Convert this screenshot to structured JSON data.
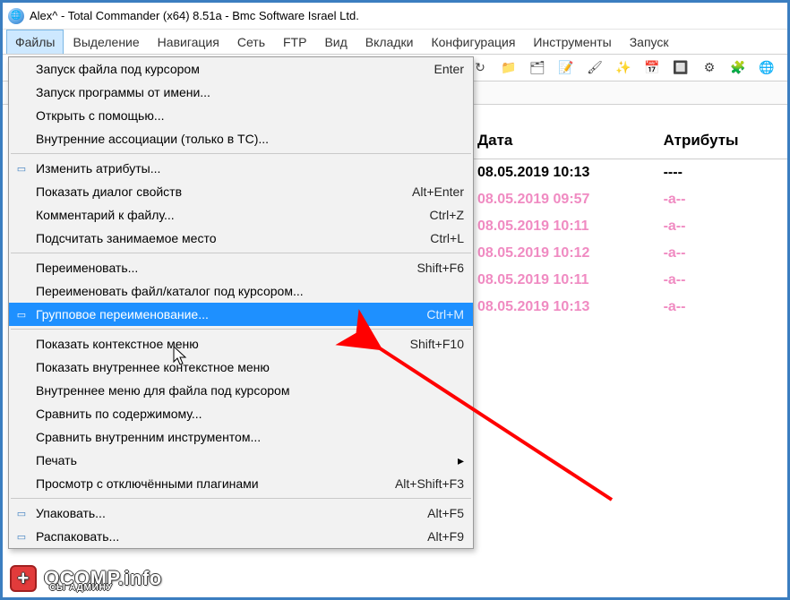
{
  "window": {
    "title": "Alex^ - Total Commander (x64) 8.51a - Bmc Software Israel Ltd."
  },
  "menubar": {
    "items": [
      "Файлы",
      "Выделение",
      "Навигация",
      "Сеть",
      "FTP",
      "Вид",
      "Вкладки",
      "Конфигурация",
      "Инструменты",
      "Запуск"
    ],
    "open_index": 0
  },
  "toolbar_icons": [
    "refresh-icon",
    "folder-icon",
    "explorer-icon",
    "notepad-icon",
    "brush-icon",
    "wand-icon",
    "calendar-icon",
    "window-icon",
    "gear-icon",
    "puzzle-icon",
    "globe-icon"
  ],
  "dropdown": {
    "groups": [
      {
        "items": [
          {
            "label": "Запуск файла под курсором",
            "shortcut": "Enter",
            "icon": null
          },
          {
            "label": "Запуск программы от имени...",
            "shortcut": "",
            "icon": null
          },
          {
            "label": "Открыть с помощью...",
            "shortcut": "",
            "icon": null
          },
          {
            "label": "Внутренние ассоциации (только в TC)...",
            "shortcut": "",
            "icon": null
          }
        ]
      },
      {
        "items": [
          {
            "label": "Изменить атрибуты...",
            "shortcut": "",
            "icon": "page-icon"
          },
          {
            "label": "Показать диалог свойств",
            "shortcut": "Alt+Enter",
            "icon": null
          },
          {
            "label": "Комментарий к файлу...",
            "shortcut": "Ctrl+Z",
            "icon": null
          },
          {
            "label": "Подсчитать занимаемое место",
            "shortcut": "Ctrl+L",
            "icon": null
          }
        ]
      },
      {
        "items": [
          {
            "label": "Переименовать...",
            "shortcut": "Shift+F6",
            "icon": null
          },
          {
            "label": "Переименовать файл/каталог под курсором...",
            "shortcut": "",
            "icon": null
          },
          {
            "label": "Групповое переименование...",
            "shortcut": "Ctrl+M",
            "icon": "rename-group-icon",
            "highlight": true
          }
        ]
      },
      {
        "items": [
          {
            "label": "Показать контекстное меню",
            "shortcut": "Shift+F10",
            "icon": null
          },
          {
            "label": "Показать внутреннее контекстное меню",
            "shortcut": "",
            "icon": null
          },
          {
            "label": "Внутреннее меню для файла под курсором",
            "shortcut": "",
            "icon": null
          },
          {
            "label": "Сравнить по содержимому...",
            "shortcut": "",
            "icon": null
          },
          {
            "label": "Сравнить внутренним инструментом...",
            "shortcut": "",
            "icon": null
          },
          {
            "label": "Печать",
            "shortcut": "",
            "icon": null,
            "submenu": true
          },
          {
            "label": "Просмотр с отключёнными плагинами",
            "shortcut": "Alt+Shift+F3",
            "icon": null
          }
        ]
      },
      {
        "items": [
          {
            "label": "Упаковать...",
            "shortcut": "Alt+F5",
            "icon": "pack-icon"
          },
          {
            "label": "Распаковать...",
            "shortcut": "Alt+F9",
            "icon": "unpack-icon"
          }
        ]
      }
    ]
  },
  "table": {
    "columns": [
      "Дата",
      "Атрибуты"
    ],
    "rows": [
      {
        "date": "08.05.2019 10:13",
        "attr": "----",
        "style": "black"
      },
      {
        "date": "08.05.2019 09:57",
        "attr": "-a--",
        "style": "pink"
      },
      {
        "date": "08.05.2019 10:11",
        "attr": "-a--",
        "style": "pink"
      },
      {
        "date": "08.05.2019 10:12",
        "attr": "-a--",
        "style": "pink"
      },
      {
        "date": "08.05.2019 10:11",
        "attr": "-a--",
        "style": "pink"
      },
      {
        "date": "08.05.2019 10:13",
        "attr": "-a--",
        "style": "pink"
      }
    ]
  },
  "watermark": {
    "main": "OCOMP.info",
    "sub": "СЫ АДМИНУ"
  }
}
